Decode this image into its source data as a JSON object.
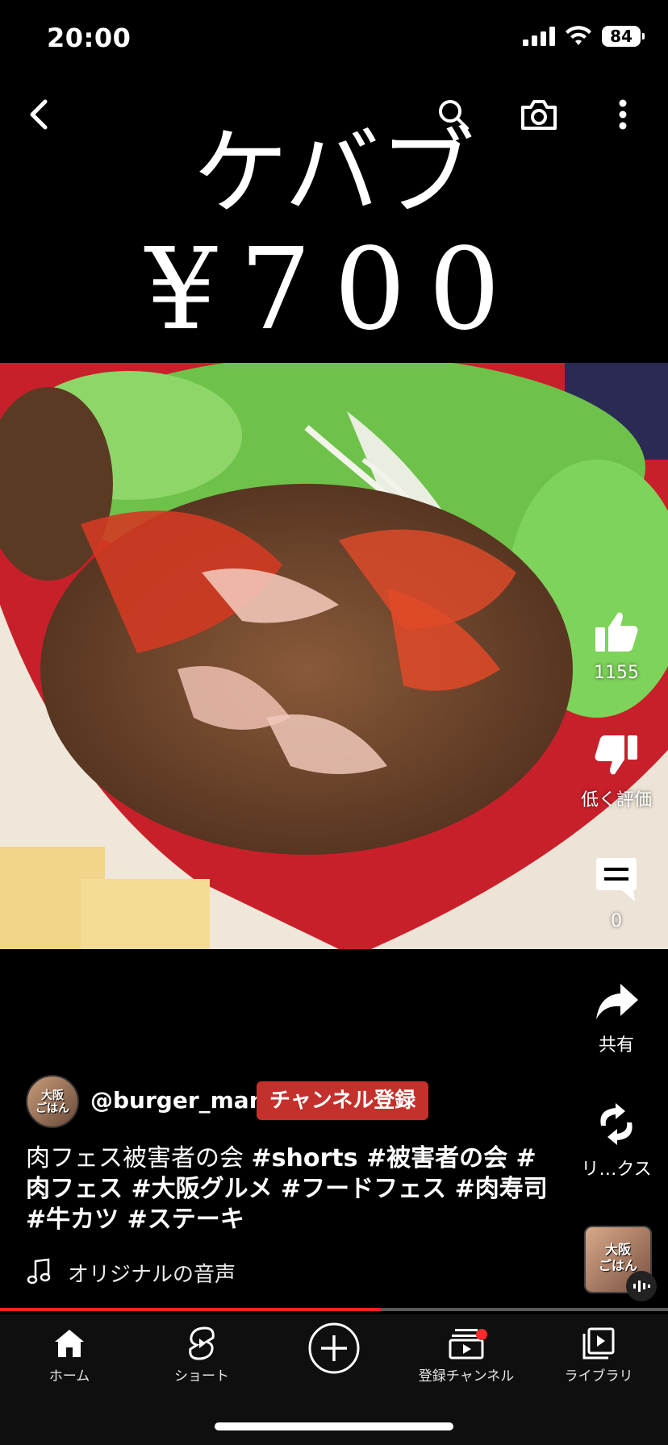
{
  "status_bar": {
    "time": "20:00",
    "battery": "84"
  },
  "video": {
    "title_line": "ケバブ",
    "price_line": "¥700"
  },
  "actions": {
    "like_count": "1155",
    "dislike_label": "低く評価",
    "comment_count": "0",
    "share_label": "共有",
    "remix_label": "リ…クス"
  },
  "channel": {
    "avatar_text": "大阪\nごはん",
    "handle": "@burger_man",
    "subscribe_label": "チャンネル登録"
  },
  "caption": {
    "text": "肉フェス被害者の会",
    "hashtags": "#shorts #被害者の会 #肉フェス #大阪グルメ #フードフェス #肉寿司 #牛カツ #ステーキ"
  },
  "sound": {
    "label": "オリジナルの音声"
  },
  "mini_thumb_text": "大阪\nごはん",
  "progress": {
    "fraction": 0.57
  },
  "nav": [
    {
      "label": "ホーム",
      "icon": "home-icon"
    },
    {
      "label": "ショート",
      "icon": "shorts-icon"
    },
    {
      "label": "",
      "icon": "create-plus-icon"
    },
    {
      "label": "登録チャンネル",
      "icon": "subscriptions-icon"
    },
    {
      "label": "ライブラリ",
      "icon": "library-icon"
    }
  ],
  "colors": {
    "accent_red": "#c4302b",
    "progress_red": "#ff2020",
    "background": "#000000"
  }
}
